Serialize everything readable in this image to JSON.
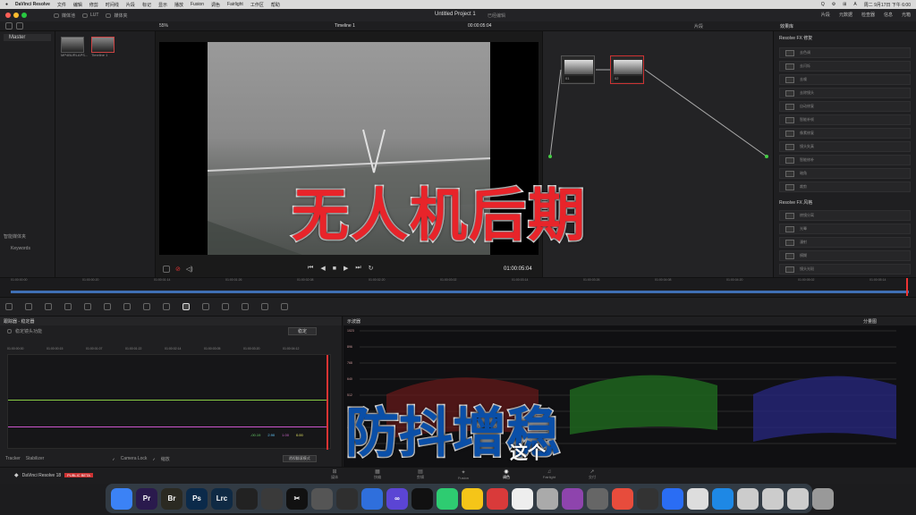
{
  "menubar": {
    "app": "DaVinci Resolve",
    "items": [
      "文件",
      "编辑",
      "修剪",
      "时间线",
      "片段",
      "标记",
      "显示",
      "播放",
      "Fusion",
      "调色",
      "Fairlight",
      "工作区",
      "帮助"
    ],
    "right": [
      "Q",
      "⚙",
      "⊞",
      "A",
      "周二 9月17日 下午 6:00"
    ]
  },
  "titlebar": {
    "tabs": [
      "媒体池",
      "LUT",
      "媒体夹"
    ],
    "project": "Untitled Project 1",
    "edited": "已经编辑",
    "right_tabs": [
      "片段",
      "元数据",
      "检查器",
      "信息",
      "光箱"
    ]
  },
  "subbar": {
    "zoom": "55%",
    "timeline": "Timeline 1",
    "timecode": "00:00:05:04",
    "mode": "片段",
    "fx_tab": "效果库"
  },
  "media": {
    "root": "Master",
    "clips": [
      "MP4BURLAPS...",
      "Timeline 1"
    ],
    "smart_bins": "智能媒体夹",
    "keywords": "Keywords"
  },
  "viewer": {
    "timecode": "01:00:05:04"
  },
  "ruler": [
    "01:00:00:00",
    "01:00:00:20",
    "01:00:01:14",
    "01:00:01:26",
    "01:00:02:08",
    "01:00:02:20",
    "01:00:03:02",
    "01:00:03:14",
    "01:00:03:26",
    "01:00:04:08",
    "01:00:04:20",
    "01:00:05:02",
    "01:00:05:14"
  ],
  "nodes": [
    {
      "label": "01"
    },
    {
      "label": "02"
    }
  ],
  "fx": {
    "section1": "Resolve FX 修复",
    "items1": [
      "去色调",
      "去闪烁",
      "去噪",
      "去除镜头",
      "自动修复",
      "智能补帧",
      "像素修复",
      "镜头失真",
      "智能修补",
      "暗角",
      "裁剪"
    ],
    "section2": "Resolve FX 风格",
    "items2": [
      "棱镜分离",
      "光晕",
      "漫射",
      "模糊",
      "镜头光斑",
      "镜头反射"
    ]
  },
  "stabilizer": {
    "title": "跟踪器 - 稳定器",
    "checkbox": "稳定镜头功能",
    "button": "稳定",
    "ticks": [
      "01:00:00:00",
      "01:00:00:15",
      "01:00:01:07",
      "01:00:01:22",
      "01:00:02:14",
      "01:00:03:05",
      "01:00:03:20",
      "01:00:04:12"
    ],
    "values": [
      "-00.19",
      "2.90",
      "1.00",
      "0.00"
    ],
    "check1": "Camera Lock",
    "check2": "缩放",
    "mode": "透视翻滚模式",
    "bottom_left": [
      "Tracker",
      "Stabilizer"
    ]
  },
  "scope": {
    "title": "示波器",
    "mode": "分量图",
    "labels": [
      "1023",
      "896",
      "768",
      "640",
      "512",
      "384",
      "256",
      "128"
    ]
  },
  "pages": [
    "媒体",
    "快编",
    "剪辑",
    "Fusion",
    "调色",
    "Fairlight",
    "交付"
  ],
  "footer": {
    "brand": "DaVinci Resolve 18",
    "badge": "PUBLIC BETA"
  },
  "overlay": {
    "title": "无人机后期",
    "subtitle": "防抖增稳",
    "caption": "这个"
  },
  "dock": [
    {
      "label": "",
      "color": "#3b82f6"
    },
    {
      "label": "Pr",
      "color": "#2a1a4d"
    },
    {
      "label": "Br",
      "color": "#2b2a22"
    },
    {
      "label": "Ps",
      "color": "#0b2a4a"
    },
    {
      "label": "Lrc",
      "color": "#0f2a44"
    },
    {
      "label": "",
      "color": "#222"
    },
    {
      "label": "",
      "color": "#3a3a3a"
    },
    {
      "label": "✂",
      "color": "#111"
    },
    {
      "label": "",
      "color": "#555"
    },
    {
      "label": "",
      "color": "#2f2f2f"
    },
    {
      "label": "",
      "color": "#2f6fdc"
    },
    {
      "label": "∞",
      "color": "#5b45d4"
    },
    {
      "label": "",
      "color": "#111"
    },
    {
      "label": "",
      "color": "#2ecc71"
    },
    {
      "label": "",
      "color": "#f5c518"
    },
    {
      "label": "",
      "color": "#d93a3a"
    },
    {
      "label": "",
      "color": "#eee"
    },
    {
      "label": "",
      "color": "#aaa"
    },
    {
      "label": "",
      "color": "#8e44ad"
    },
    {
      "label": "",
      "color": "#666"
    },
    {
      "label": "",
      "color": "#e74c3c"
    },
    {
      "label": "",
      "color": "#333"
    },
    {
      "label": "",
      "color": "#2a6df4"
    },
    {
      "label": "",
      "color": "#ddd"
    },
    {
      "label": "",
      "color": "#1e88e5"
    },
    {
      "label": "",
      "color": "#ccc"
    },
    {
      "label": "",
      "color": "#ccc"
    },
    {
      "label": "",
      "color": "#ccc"
    },
    {
      "label": "",
      "color": "#999"
    }
  ]
}
